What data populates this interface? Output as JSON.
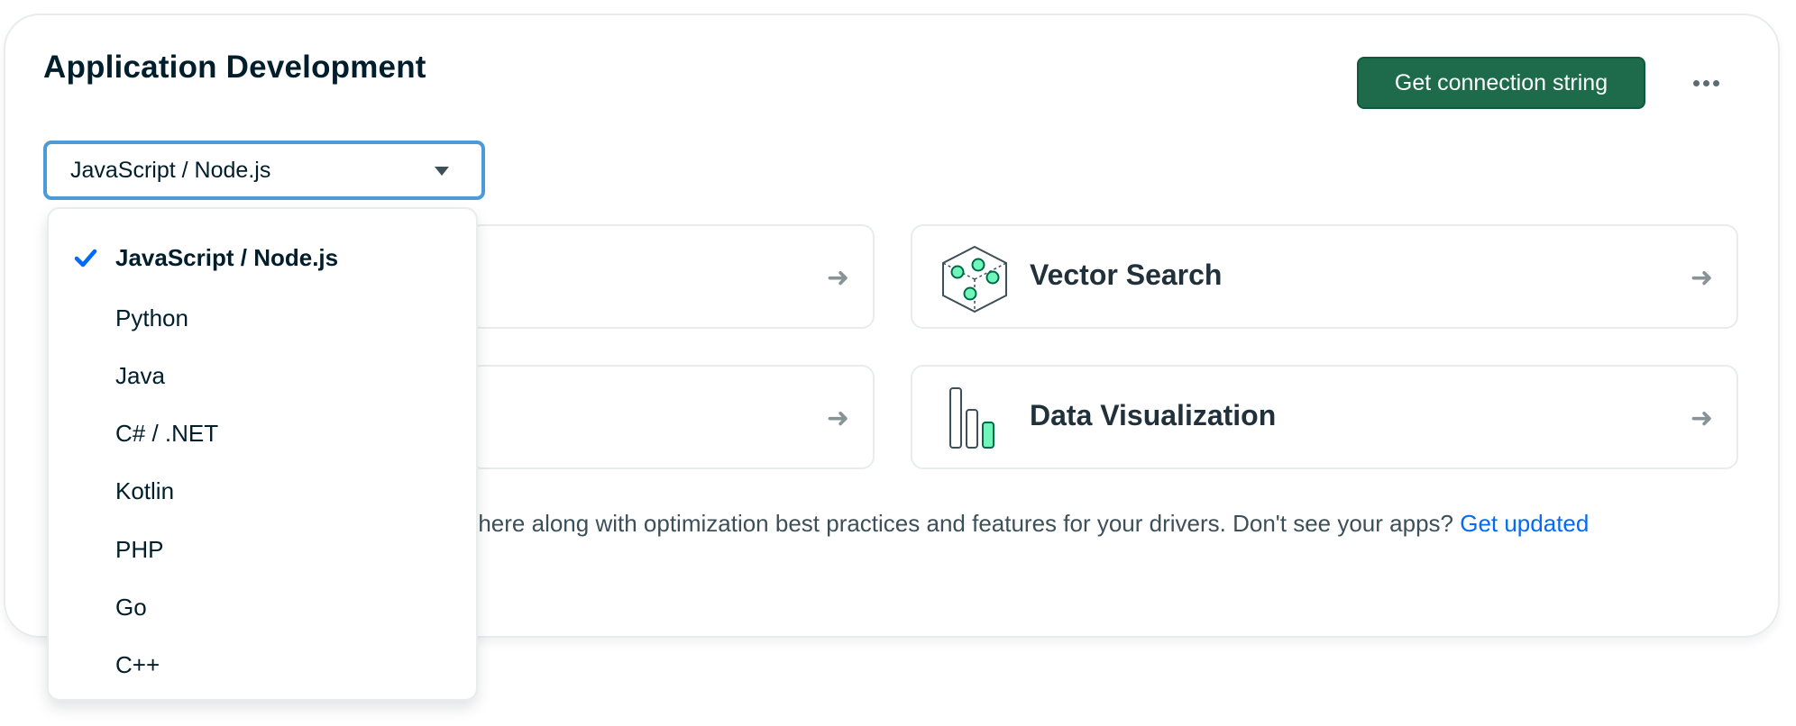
{
  "header": {
    "title": "Application Development",
    "connection_button": "Get connection string",
    "more_icon": "ellipsis-icon"
  },
  "language_select": {
    "value": "JavaScript / Node.js",
    "options": [
      {
        "label": "JavaScript / Node.js",
        "selected": true
      },
      {
        "label": "Python",
        "selected": false
      },
      {
        "label": "Java",
        "selected": false
      },
      {
        "label": "C# / .NET",
        "selected": false
      },
      {
        "label": "Kotlin",
        "selected": false
      },
      {
        "label": "PHP",
        "selected": false
      },
      {
        "label": "Go",
        "selected": false
      },
      {
        "label": "C++",
        "selected": false
      }
    ]
  },
  "tiles": [
    {
      "label": "",
      "icon": "arrow-right-icon"
    },
    {
      "label": "Vector Search",
      "icon": "vector-search-icon"
    },
    {
      "label": "",
      "icon": "arrow-right-icon"
    },
    {
      "label": "Data Visualization",
      "icon": "bar-chart-icon"
    }
  ],
  "info": {
    "text": "ar here along with optimization best practices and features for your drivers. Don't see your apps? ",
    "link": "Get updated"
  },
  "colors": {
    "primary_button": "#1e6b4c",
    "focus_border": "#4d9ad8",
    "link": "#016bf8",
    "check": "#016bf8",
    "accent_green": "#71f6ba"
  }
}
